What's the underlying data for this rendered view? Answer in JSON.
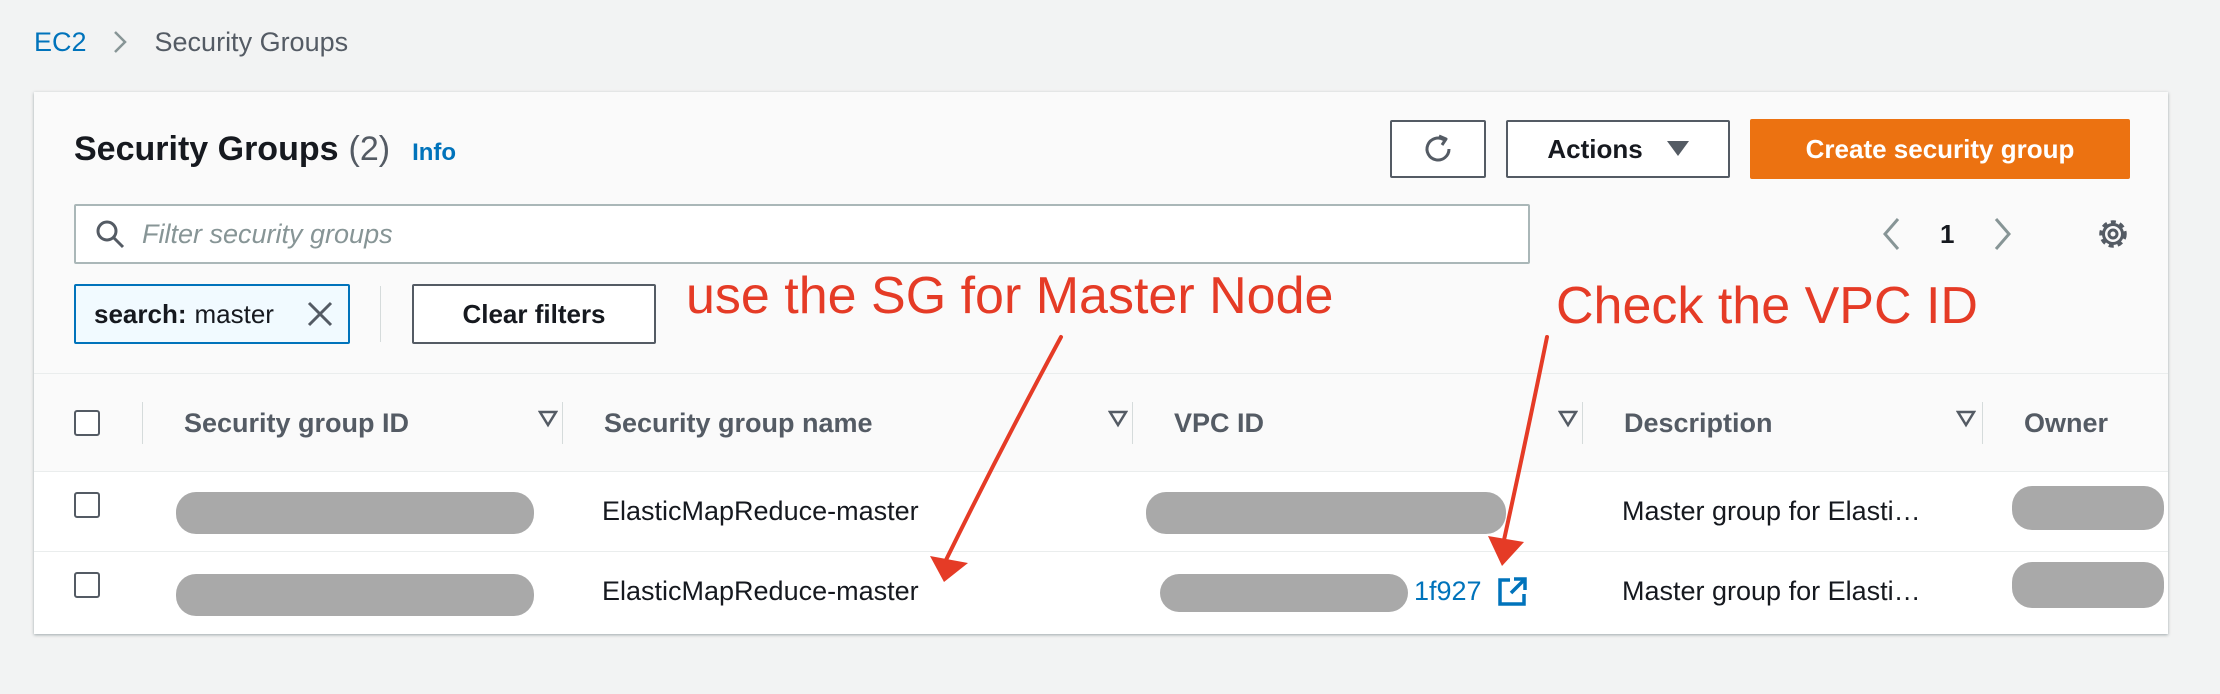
{
  "breadcrumb": {
    "root": "EC2",
    "current": "Security Groups"
  },
  "header": {
    "title": "Security Groups",
    "count": "(2)",
    "info": "Info"
  },
  "toolbar": {
    "actions_label": "Actions",
    "create_label": "Create security group",
    "refresh_icon": "refresh-icon"
  },
  "search": {
    "placeholder": "Filter security groups",
    "value": ""
  },
  "filter": {
    "token_key": "search:",
    "token_value": "master",
    "clear_label": "Clear filters"
  },
  "pagination": {
    "page": "1"
  },
  "table": {
    "columns": [
      "Security group ID",
      "Security group name",
      "VPC ID",
      "Description",
      "Owner"
    ],
    "rows": [
      {
        "name": "ElasticMapReduce-master",
        "vpc_suffix": "",
        "description": "Master group for Elasti…"
      },
      {
        "name": "ElasticMapReduce-master",
        "vpc_suffix": "1f927",
        "description": "Master group for Elasti…"
      }
    ]
  },
  "annotations": {
    "sg_note": "use the SG for Master Node",
    "vpc_note": "Check the VPC ID",
    "color": "#e53b26"
  },
  "colors": {
    "accent": "#0073bb",
    "primary_button": "#ec7211",
    "redaction": "#a9a9a9"
  }
}
